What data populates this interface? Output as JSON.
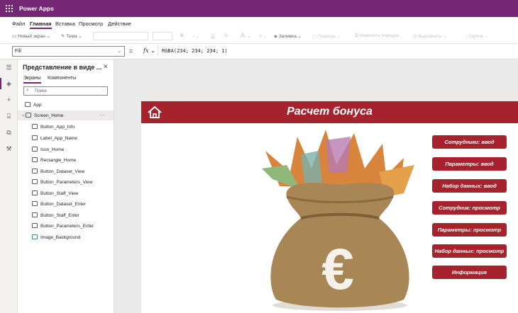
{
  "app": {
    "title": "Power Apps"
  },
  "menu": {
    "items": [
      "Файл",
      "Главная",
      "Вставка",
      "Просмотр",
      "Действие"
    ],
    "active": "Главная"
  },
  "toolbar": {
    "new_screen": "Новый экран",
    "theme": "Тема",
    "bold": "B",
    "fill": "Заливка",
    "border": "Граница",
    "reorder": "Изменить порядок",
    "align": "Выровнять",
    "group": "Группа"
  },
  "formula_bar": {
    "property": "Fill",
    "equals": "=",
    "fx": "fx",
    "formula": "RGBA(234; 234; 234; 1)"
  },
  "tree_view": {
    "title": "Представление в виде ...",
    "tabs": [
      "Экраны",
      "Компоненты"
    ],
    "active_tab": "Экраны",
    "search_placeholder": "Поиск",
    "app_node": "App",
    "screen_node": "Screen_Home",
    "controls": [
      "Button_App_Info",
      "Label_App_Name",
      "Icon_Home",
      "Rectangle_Home",
      "Button_Dataset_View",
      "Button_Parameters_View",
      "Button_Staff_View",
      "Button_Dataset_Enter",
      "Button_Staff_Enter",
      "Button_Parameters_Enter",
      "Image_Background"
    ]
  },
  "screen": {
    "title": "Расчет бонуса",
    "buttons": [
      "Сотрудники: ввод",
      "Параметры: ввод",
      "Набор данных: ввод",
      "Сотрудник: просмотр",
      "Параметры: просмотр",
      "Набор данных: просмотр",
      "Информация"
    ]
  },
  "colors": {
    "brand": "#742774",
    "accent_red": "#a6232d",
    "canvas": "#eaeaea"
  }
}
